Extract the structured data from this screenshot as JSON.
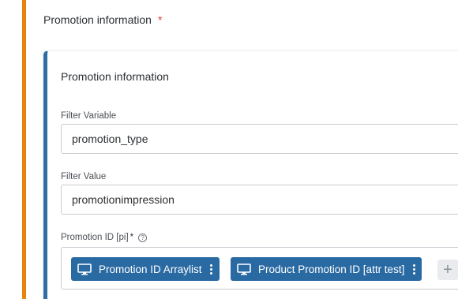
{
  "section": {
    "title": "Promotion information",
    "required_mark": "*"
  },
  "card": {
    "title": "Promotion information"
  },
  "fields": {
    "filter_variable": {
      "label": "Filter Variable",
      "value": "promotion_type"
    },
    "filter_value": {
      "label": "Filter Value",
      "value": "promotionimpression"
    },
    "promotion_id": {
      "label": "Promotion ID [pi]",
      "required_mark": "*",
      "help_icon": "help-circle-icon",
      "chips": [
        {
          "label": "Promotion ID Arraylist",
          "icon": "monitor-icon"
        },
        {
          "label": "Product Promotion ID [attr test]",
          "icon": "monitor-icon"
        }
      ],
      "add_icon": "plus-icon",
      "add_label": "+"
    }
  },
  "colors": {
    "outer_accent": "#e8830e",
    "inner_accent": "#2f6da3",
    "chip_bg": "#2a6aa3",
    "required": "#e23a3a"
  }
}
